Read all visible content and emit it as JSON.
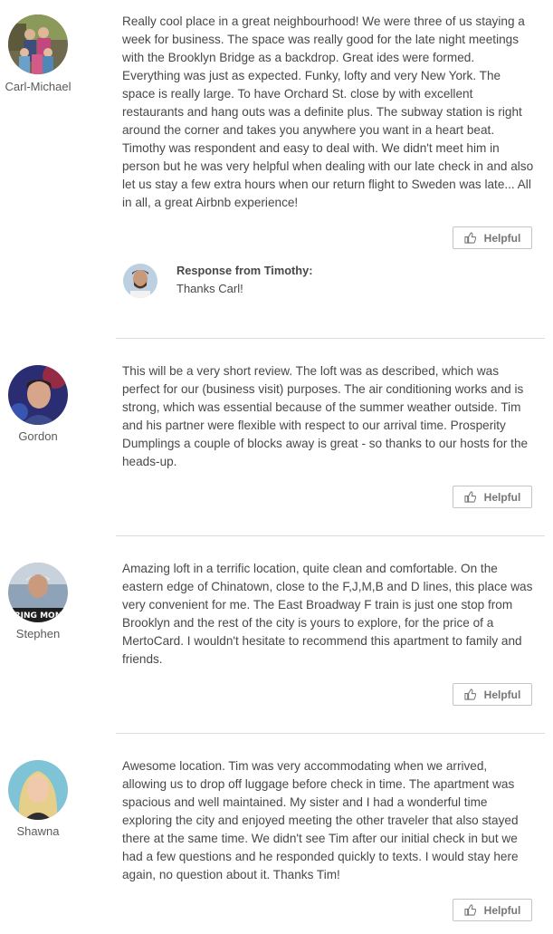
{
  "reviews": [
    {
      "name": "Carl-Michael",
      "avatar_icon": "avatar-family-photo",
      "text": "Really cool place in a great neighbourhood! We were three of us staying a week for business. The space was really good for the late night meetings with the Brooklyn Bridge as a backdrop. Great ides were formed. Everything was just as expected. Funky, lofty and very New York. The space is really large. To have Orchard St. close by with excellent restaurants and hang outs was a definite plus. The subway station is right around the corner and takes you anywhere you want in a heart beat. Timothy was respondent and easy to deal with. We didn't meet him in person but he was very helpful when dealing with our late check in and also let us stay a few extra hours when our return flight to Sweden was late... All in all, a great Airbnb experience!",
      "helpful_label": "Helpful",
      "response": {
        "title": "Response from Timothy:",
        "text": "Thanks Carl!",
        "avatar_icon": "avatar-host-photo"
      }
    },
    {
      "name": "Gordon",
      "avatar_icon": "avatar-man-photo",
      "text": "This will be a very short review. The loft was as described, which was perfect for our (business visit) purposes. The air conditioning works and is strong, which was essential because of the summer weather outside. Tim and his partner were flexible with respect to our arrival time. Prosperity Dumplings a couple of blocks away is great - so thanks to our hosts for the heads-up.",
      "helpful_label": "Helpful"
    },
    {
      "name": "Stephen",
      "avatar_icon": "avatar-man-cap-photo",
      "avatar_sign_text": "RING MON",
      "text": "Amazing loft in a terrific location, quite clean and comfortable. On the eastern edge of Chinatown, close to the F,J,M,B and D lines, this place was very convenient for me. The East Broadway F train is just one stop from Brooklyn and the rest of the city is yours to explore, for the price of a MertoCard. I wouldn't hesitate to recommend this apartment to family and friends.",
      "helpful_label": "Helpful"
    },
    {
      "name": "Shawna",
      "avatar_icon": "avatar-woman-photo",
      "text": "Awesome location. Tim was very accommodating when we arrived, allowing us to drop off luggage before check in time. The apartment was spacious and well maintained. My sister and I had a wonderful time exploring the city and enjoyed meeting the other traveler that also stayed there at the same time. We didn't see Tim after our initial check in but we had a few questions and he responded quickly to texts. I would stay here again, no question about it. Thanks Tim!",
      "helpful_label": "Helpful"
    }
  ],
  "colors": {
    "text": "#484848",
    "divider": "#dcdcdc",
    "button_border": "#c4c4c4",
    "button_text": "#767676"
  }
}
